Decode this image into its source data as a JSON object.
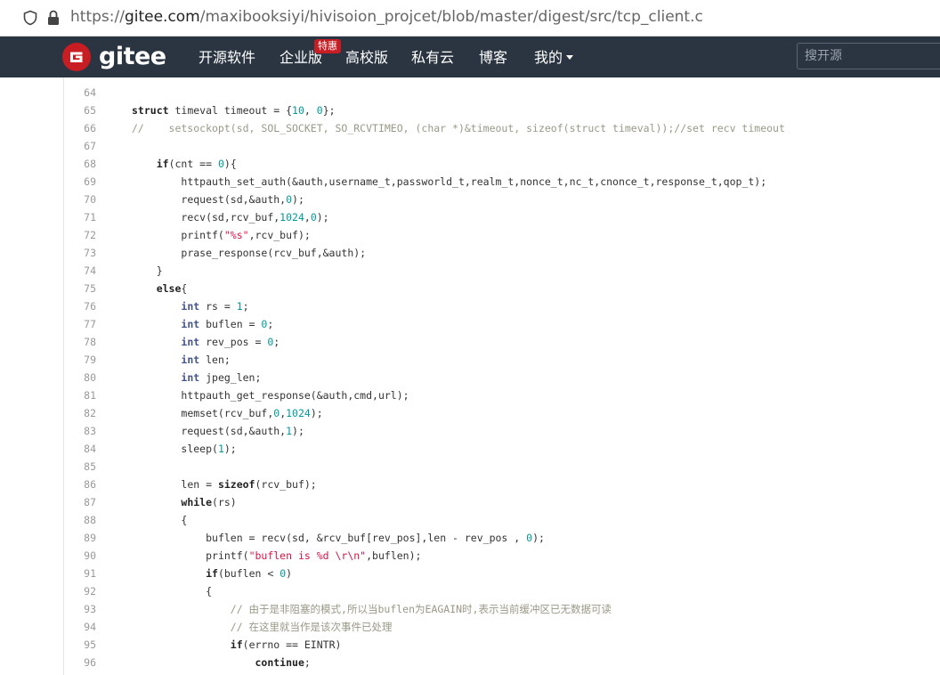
{
  "browser": {
    "url_scheme": "https://",
    "url_host": "gitee.com",
    "url_path": "/maxibooksiyi/hivisoion_projcet/blob/master/digest/src/tcp_client.c"
  },
  "navbar": {
    "brand": "gitee",
    "items": [
      {
        "label": "开源软件"
      },
      {
        "label": "企业版"
      },
      {
        "label": "高校版"
      },
      {
        "label": "私有云"
      },
      {
        "label": "博客"
      },
      {
        "label": "我的"
      }
    ],
    "badge": "特惠",
    "search_placeholder": "搜开源"
  },
  "code": {
    "lines": [
      {
        "num": "64",
        "indent": "",
        "tokens": []
      },
      {
        "num": "65",
        "indent": "",
        "tokens": [
          [
            "k",
            "struct"
          ],
          [
            "p",
            " timeval timeout = {"
          ],
          [
            "n",
            "10"
          ],
          [
            "p",
            ", "
          ],
          [
            "n",
            "0"
          ],
          [
            "p",
            "};"
          ]
        ]
      },
      {
        "num": "66",
        "indent": "",
        "tokens": [
          [
            "c",
            "//    setsockopt(sd, SOL_SOCKET, SO_RCVTIMEO, (char *)&timeout, sizeof(struct timeval));//set recv timeout"
          ]
        ]
      },
      {
        "num": "67",
        "indent": "",
        "tokens": []
      },
      {
        "num": "68",
        "indent": "    ",
        "tokens": [
          [
            "k",
            "if"
          ],
          [
            "p",
            "(cnt == "
          ],
          [
            "n",
            "0"
          ],
          [
            "p",
            "){"
          ]
        ]
      },
      {
        "num": "69",
        "indent": "        ",
        "tokens": [
          [
            "p",
            "httpauth_set_auth(&auth,username_t,passworld_t,realm_t,nonce_t,nc_t,cnonce_t,response_t,qop_t);"
          ]
        ]
      },
      {
        "num": "70",
        "indent": "        ",
        "tokens": [
          [
            "p",
            "request(sd,&auth,"
          ],
          [
            "n",
            "0"
          ],
          [
            "p",
            ");"
          ]
        ]
      },
      {
        "num": "71",
        "indent": "        ",
        "tokens": [
          [
            "p",
            "recv(sd,rcv_buf,"
          ],
          [
            "n",
            "1024"
          ],
          [
            "p",
            ","
          ],
          [
            "n",
            "0"
          ],
          [
            "p",
            ");"
          ]
        ]
      },
      {
        "num": "72",
        "indent": "        ",
        "tokens": [
          [
            "p",
            "printf("
          ],
          [
            "s",
            "\"%s\""
          ],
          [
            "p",
            ",rcv_buf);"
          ]
        ]
      },
      {
        "num": "73",
        "indent": "        ",
        "tokens": [
          [
            "p",
            "prase_response(rcv_buf,&auth);"
          ]
        ]
      },
      {
        "num": "74",
        "indent": "    ",
        "tokens": [
          [
            "p",
            "}"
          ]
        ]
      },
      {
        "num": "75",
        "indent": "    ",
        "tokens": [
          [
            "k",
            "else"
          ],
          [
            "p",
            "{"
          ]
        ]
      },
      {
        "num": "76",
        "indent": "        ",
        "tokens": [
          [
            "kb",
            "int"
          ],
          [
            "p",
            " rs = "
          ],
          [
            "n",
            "1"
          ],
          [
            "p",
            ";"
          ]
        ]
      },
      {
        "num": "77",
        "indent": "        ",
        "tokens": [
          [
            "kb",
            "int"
          ],
          [
            "p",
            " buflen = "
          ],
          [
            "n",
            "0"
          ],
          [
            "p",
            ";"
          ]
        ]
      },
      {
        "num": "78",
        "indent": "        ",
        "tokens": [
          [
            "kb",
            "int"
          ],
          [
            "p",
            " rev_pos = "
          ],
          [
            "n",
            "0"
          ],
          [
            "p",
            ";"
          ]
        ]
      },
      {
        "num": "79",
        "indent": "        ",
        "tokens": [
          [
            "kb",
            "int"
          ],
          [
            "p",
            " len;"
          ]
        ]
      },
      {
        "num": "80",
        "indent": "        ",
        "tokens": [
          [
            "kb",
            "int"
          ],
          [
            "p",
            " jpeg_len;"
          ]
        ]
      },
      {
        "num": "81",
        "indent": "        ",
        "tokens": [
          [
            "p",
            "httpauth_get_response(&auth,cmd,url);"
          ]
        ]
      },
      {
        "num": "82",
        "indent": "        ",
        "tokens": [
          [
            "p",
            "memset(rcv_buf,"
          ],
          [
            "n",
            "0"
          ],
          [
            "p",
            ","
          ],
          [
            "n",
            "1024"
          ],
          [
            "p",
            ");"
          ]
        ]
      },
      {
        "num": "83",
        "indent": "        ",
        "tokens": [
          [
            "p",
            "request(sd,&auth,"
          ],
          [
            "n",
            "1"
          ],
          [
            "p",
            ");"
          ]
        ]
      },
      {
        "num": "84",
        "indent": "        ",
        "tokens": [
          [
            "p",
            "sleep("
          ],
          [
            "n",
            "1"
          ],
          [
            "p",
            ");"
          ]
        ]
      },
      {
        "num": "85",
        "indent": "",
        "tokens": []
      },
      {
        "num": "86",
        "indent": "        ",
        "tokens": [
          [
            "p",
            "len = "
          ],
          [
            "k",
            "sizeof"
          ],
          [
            "p",
            "(rcv_buf);"
          ]
        ]
      },
      {
        "num": "87",
        "indent": "        ",
        "tokens": [
          [
            "k",
            "while"
          ],
          [
            "p",
            "(rs)"
          ]
        ]
      },
      {
        "num": "88",
        "indent": "        ",
        "tokens": [
          [
            "p",
            "{"
          ]
        ]
      },
      {
        "num": "89",
        "indent": "            ",
        "tokens": [
          [
            "p",
            "buflen = recv(sd, &rcv_buf[rev_pos],len - rev_pos , "
          ],
          [
            "n",
            "0"
          ],
          [
            "p",
            ");"
          ]
        ]
      },
      {
        "num": "90",
        "indent": "            ",
        "tokens": [
          [
            "p",
            "printf("
          ],
          [
            "s",
            "\"buflen is %d \\r\\n\""
          ],
          [
            "p",
            ",buflen);"
          ]
        ]
      },
      {
        "num": "91",
        "indent": "            ",
        "tokens": [
          [
            "k",
            "if"
          ],
          [
            "p",
            "(buflen < "
          ],
          [
            "n",
            "0"
          ],
          [
            "p",
            ")"
          ]
        ]
      },
      {
        "num": "92",
        "indent": "            ",
        "tokens": [
          [
            "p",
            "{"
          ]
        ]
      },
      {
        "num": "93",
        "indent": "                ",
        "tokens": [
          [
            "c",
            "// 由于是非阻塞的模式,所以当buflen为EAGAIN时,表示当前缓冲区已无数据可读"
          ]
        ]
      },
      {
        "num": "94",
        "indent": "                ",
        "tokens": [
          [
            "c",
            "// 在这里就当作是该次事件已处理"
          ]
        ]
      },
      {
        "num": "95",
        "indent": "                ",
        "tokens": [
          [
            "k",
            "if"
          ],
          [
            "p",
            "(errno == EINTR)"
          ]
        ]
      },
      {
        "num": "96",
        "indent": "                    ",
        "tokens": [
          [
            "k",
            "continue"
          ],
          [
            "p",
            ";"
          ]
        ]
      }
    ]
  }
}
